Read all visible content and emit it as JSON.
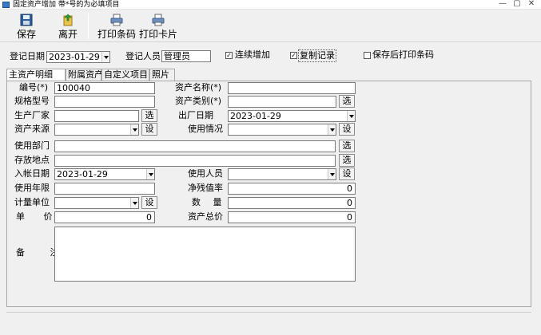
{
  "window": {
    "title": "固定资产增加 带*号的为必填项目",
    "controls": [
      "—",
      "▢",
      "✕"
    ]
  },
  "toolbar": {
    "save": "保存",
    "leave": "离开",
    "print_barcode": "打印条码",
    "print_card": "打印卡片"
  },
  "header": {
    "reg_date_label": "登记日期",
    "reg_date_value": "2023-01-29",
    "registrar_label": "登记人员",
    "registrar_value": "管理员",
    "continuous_add_label": "连续增加",
    "continuous_add_checked": true,
    "copy_record_label": "复制记录",
    "copy_record_checked": true,
    "print_after_save_label": "保存后打印条码",
    "print_after_save_checked": false
  },
  "tabs": [
    "主资产明细",
    "附属资产",
    "自定义项目",
    "照片"
  ],
  "form": {
    "asset_no_label": "编号(*)",
    "asset_no_value": "100040",
    "asset_name_label": "资产名称(*)",
    "asset_name_value": "",
    "spec_label": "规格型号",
    "spec_value": "",
    "category_label": "资产类别(*)",
    "category_value": "",
    "manufacturer_label": "生产厂家",
    "manufacturer_value": "",
    "factory_date_label": "出厂日期",
    "factory_date_value": "2023-01-29",
    "source_label": "资产来源",
    "source_value": "",
    "usage_label": "使用情况",
    "usage_value": "",
    "dept_label": "使用部门",
    "dept_value": "",
    "location_label": "存放地点",
    "location_value": "",
    "entry_date_label": "入帐日期",
    "entry_date_value": "2023-01-29",
    "user_label": "使用人员",
    "user_value": "",
    "life_label": "使用年限",
    "life_value": "",
    "residual_label": "净残值率",
    "residual_value": "0",
    "unit_label": "计量单位",
    "unit_value": "",
    "qty_label": "数 量",
    "qty_value": "0",
    "price_label": "单 价",
    "price_value": "0",
    "total_label": "资产总价",
    "total_value": "0",
    "remark_label": "备 注",
    "remark_value": ""
  },
  "buttons": {
    "select": "选",
    "set": "设"
  },
  "icons": {
    "save": "floppy-disk-icon",
    "leave": "exit-door-icon",
    "print_barcode": "printer-icon",
    "print_card": "printer-icon"
  }
}
